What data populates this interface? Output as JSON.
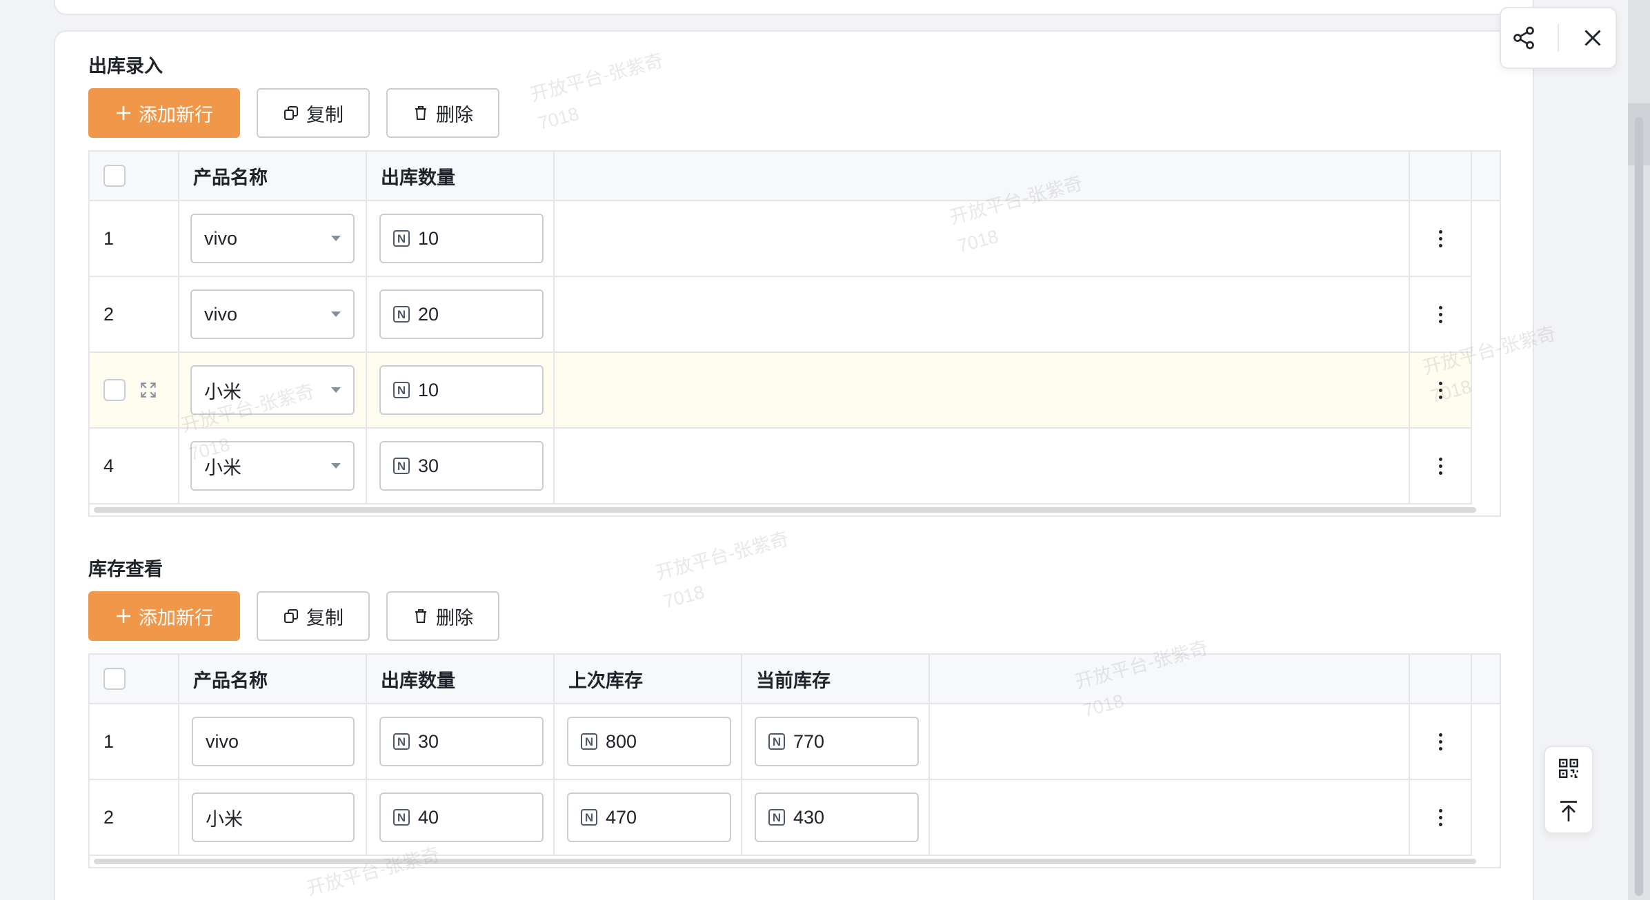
{
  "section1": {
    "title": "出库录入",
    "add_label": "添加新行",
    "copy_label": "复制",
    "delete_label": "删除",
    "columns": [
      "产品名称",
      "出库数量"
    ],
    "rows": [
      {
        "index": "1",
        "product": "vivo",
        "qty": "10"
      },
      {
        "index": "2",
        "product": "vivo",
        "qty": "20"
      },
      {
        "index": "",
        "product": "小米",
        "qty": "10"
      },
      {
        "index": "4",
        "product": "小米",
        "qty": "30"
      }
    ]
  },
  "section2": {
    "title": "库存查看",
    "add_label": "添加新行",
    "copy_label": "复制",
    "delete_label": "删除",
    "columns": [
      "产品名称",
      "出库数量",
      "上次库存",
      "当前库存"
    ],
    "rows": [
      {
        "index": "1",
        "product": "vivo",
        "qty": "30",
        "last": "800",
        "current": "770"
      },
      {
        "index": "2",
        "product": "小米",
        "qty": "40",
        "last": "470",
        "current": "430"
      }
    ]
  },
  "watermark": {
    "line1": "开放平台-张紫奇",
    "line2": "7018"
  },
  "icons": {
    "share": "share-icon",
    "close": "close-icon",
    "qrcode": "qrcode-icon",
    "back_to_top": "back-to-top-icon",
    "more": "more-vertical-icon",
    "expand": "expand-icon",
    "number": "number-icon",
    "copy": "copy-icon",
    "delete": "trash-icon",
    "plus": "plus-icon"
  },
  "colors": {
    "primary": "#f0974a",
    "highlight_row": "#fffcf0"
  }
}
